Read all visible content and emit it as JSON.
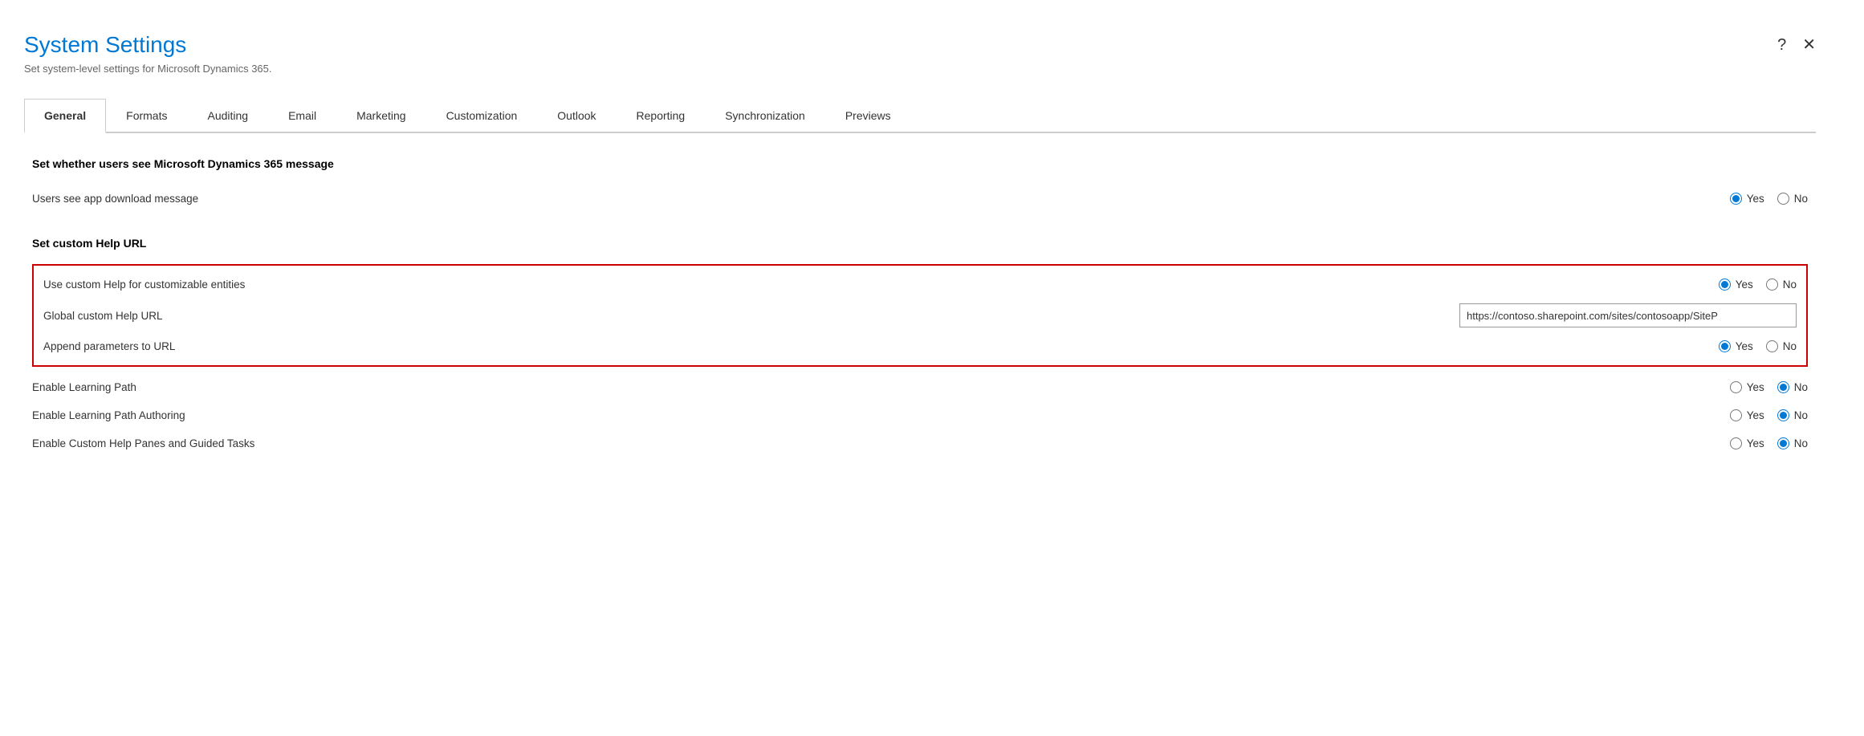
{
  "dialog": {
    "title": "System Settings",
    "subtitle": "Set system-level settings for Microsoft Dynamics 365.",
    "help_icon": "?",
    "close_icon": "✕"
  },
  "tabs": [
    {
      "id": "general",
      "label": "General",
      "active": true
    },
    {
      "id": "formats",
      "label": "Formats",
      "active": false
    },
    {
      "id": "auditing",
      "label": "Auditing",
      "active": false
    },
    {
      "id": "email",
      "label": "Email",
      "active": false
    },
    {
      "id": "marketing",
      "label": "Marketing",
      "active": false
    },
    {
      "id": "customization",
      "label": "Customization",
      "active": false
    },
    {
      "id": "outlook",
      "label": "Outlook",
      "active": false
    },
    {
      "id": "reporting",
      "label": "Reporting",
      "active": false
    },
    {
      "id": "synchronization",
      "label": "Synchronization",
      "active": false
    },
    {
      "id": "previews",
      "label": "Previews",
      "active": false
    }
  ],
  "sections": {
    "microsoft_message": {
      "title": "Set whether users see Microsoft Dynamics 365 message",
      "rows": [
        {
          "id": "app_download_message",
          "label": "Users see app download message",
          "type": "radio",
          "value": "yes",
          "options": [
            "Yes",
            "No"
          ]
        }
      ]
    },
    "custom_help": {
      "title": "Set custom Help URL",
      "highlighted_rows": [
        {
          "id": "use_custom_help",
          "label": "Use custom Help for customizable entities",
          "type": "radio",
          "value": "yes",
          "options": [
            "Yes",
            "No"
          ]
        },
        {
          "id": "global_custom_help_url",
          "label": "Global custom Help URL",
          "type": "text",
          "value": "https://contoso.sharepoint.com/sites/contosoapp/SiteP"
        },
        {
          "id": "append_parameters",
          "label": "Append parameters to URL",
          "type": "radio",
          "value": "yes",
          "options": [
            "Yes",
            "No"
          ]
        }
      ],
      "extra_rows": [
        {
          "id": "enable_learning_path",
          "label": "Enable Learning Path",
          "type": "radio",
          "value": "no",
          "options": [
            "Yes",
            "No"
          ]
        },
        {
          "id": "enable_learning_path_authoring",
          "label": "Enable Learning Path Authoring",
          "type": "radio",
          "value": "no",
          "options": [
            "Yes",
            "No"
          ]
        },
        {
          "id": "enable_custom_help_panes",
          "label": "Enable Custom Help Panes and Guided Tasks",
          "type": "radio",
          "value": "no",
          "options": [
            "Yes",
            "No"
          ]
        }
      ]
    }
  }
}
